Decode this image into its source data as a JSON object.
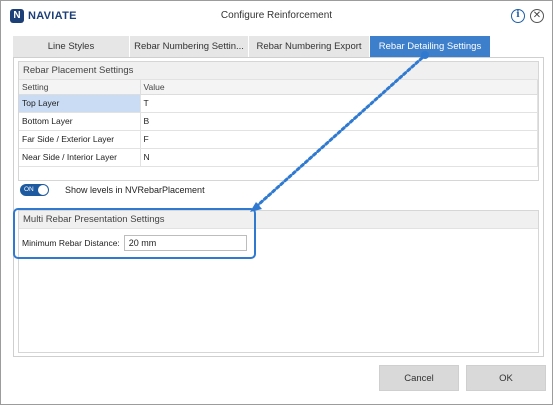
{
  "app": {
    "logo_letter": "N",
    "logo_text": "NAVIATE",
    "title": "Configure Reinforcement"
  },
  "titlebar": {
    "info_glyph": "i",
    "close_glyph": "✕"
  },
  "tabs": [
    {
      "label": "Line Styles",
      "active": false
    },
    {
      "label": "Rebar  Numbering Settin...",
      "active": false
    },
    {
      "label": "Rebar Numbering Export",
      "active": false
    },
    {
      "label": "Rebar Detailing Settings",
      "active": true
    }
  ],
  "placement": {
    "header": "Rebar Placement Settings",
    "columns": [
      "Setting",
      "Value"
    ],
    "rows": [
      {
        "setting": "Top Layer",
        "value": "T",
        "selected": true
      },
      {
        "setting": "Bottom Layer",
        "value": "B",
        "selected": false
      },
      {
        "setting": "Far Side / Exterior Layer",
        "value": "F",
        "selected": false
      },
      {
        "setting": "Near Side / Interior Layer",
        "value": "N",
        "selected": false
      }
    ],
    "toggle_text": "ON",
    "toggle_state": true,
    "toggle_label": "Show levels in NVRebarPlacement"
  },
  "multi": {
    "header": "Multi Rebar Presentation Settings",
    "min_distance_label": "Minimum Rebar Distance:",
    "min_distance_value": "20 mm"
  },
  "buttons": {
    "cancel": "Cancel",
    "ok": "OK"
  },
  "colors": {
    "accent": "#3d7fca",
    "annotation": "#2f7ad0",
    "toggle_on": "#1e5aa0",
    "brand": "#1d3f77"
  },
  "icons": {
    "info": "info-icon",
    "close": "close-icon",
    "logo": "naviate-logo-icon"
  }
}
